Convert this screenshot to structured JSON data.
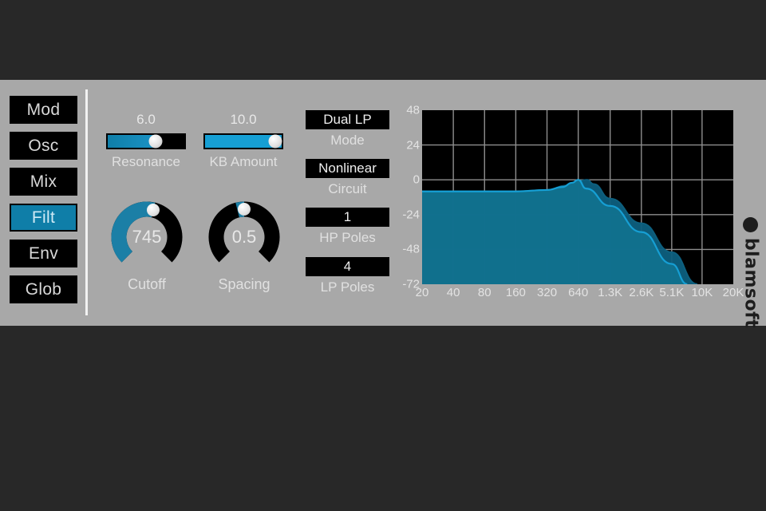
{
  "app": {
    "brand": "blamsoft",
    "panel_bg": "#a8a8a8",
    "accent": "#0f7ea8",
    "accent_bright": "#169fd4",
    "background": "#282828"
  },
  "sidebar": {
    "items": [
      {
        "label": "Mod",
        "active": false
      },
      {
        "label": "Osc",
        "active": false
      },
      {
        "label": "Mix",
        "active": false
      },
      {
        "label": "Filt",
        "active": true
      },
      {
        "label": "Env",
        "active": false
      },
      {
        "label": "Glob",
        "active": false
      }
    ]
  },
  "sliders": [
    {
      "name": "resonance",
      "label": "Resonance",
      "value": "6.0",
      "percent": 62,
      "color": "#0f7ea8"
    },
    {
      "name": "kb-amount",
      "label": "KB Amount",
      "value": "10.0",
      "percent": 100,
      "color": "#169fd4"
    }
  ],
  "knobs": [
    {
      "name": "cutoff",
      "label": "Cutoff",
      "value": "745",
      "percent": 55,
      "color": "#1b7fa6"
    },
    {
      "name": "spacing",
      "label": "Spacing",
      "value": "0.5",
      "percent": 50,
      "color": "#1b7fa6"
    }
  ],
  "selectors": [
    {
      "name": "mode",
      "value": "Dual LP",
      "label": "Mode"
    },
    {
      "name": "circuit",
      "value": "Nonlinear",
      "label": "Circuit"
    },
    {
      "name": "hp-poles",
      "value": "1",
      "label": "HP Poles"
    },
    {
      "name": "lp-poles",
      "value": "4",
      "label": "LP Poles"
    }
  ],
  "chart_data": {
    "type": "line",
    "title": "",
    "xlabel": "",
    "ylabel": "",
    "xscale": "log",
    "xlim": [
      20,
      20000
    ],
    "ylim": [
      -72,
      48
    ],
    "grid": true,
    "legend": "none",
    "x_ticks": [
      "20",
      "40",
      "80",
      "160",
      "320",
      "640",
      "1.3K",
      "2.6K",
      "5.1K",
      "10K",
      "20K"
    ],
    "x_tick_values": [
      20,
      40,
      80,
      160,
      320,
      640,
      1300,
      2600,
      5100,
      10000,
      20000
    ],
    "y_ticks": [
      "48",
      "24",
      "0",
      "-24",
      "-48",
      "-72"
    ],
    "y_tick_values": [
      48,
      24,
      0,
      -24,
      -48,
      -72
    ],
    "series": [
      {
        "name": "filter-response-back",
        "color": "#0d5f7e",
        "x": [
          20,
          40,
          80,
          160,
          320,
          500,
          640,
          780,
          900,
          1300,
          2600,
          5100,
          9000
        ],
        "values": [
          -8,
          -8,
          -8,
          -8,
          -7,
          -4,
          -1,
          0,
          -3,
          -13,
          -30,
          -50,
          -72
        ]
      },
      {
        "name": "filter-response-front",
        "color": "#169fd4",
        "x": [
          20,
          40,
          80,
          160,
          320,
          450,
          560,
          640,
          760,
          1300,
          2600,
          5100,
          7200
        ],
        "values": [
          -8,
          -8,
          -8,
          -8,
          -7,
          -5,
          -2,
          0,
          -6,
          -18,
          -36,
          -58,
          -72
        ]
      }
    ]
  }
}
